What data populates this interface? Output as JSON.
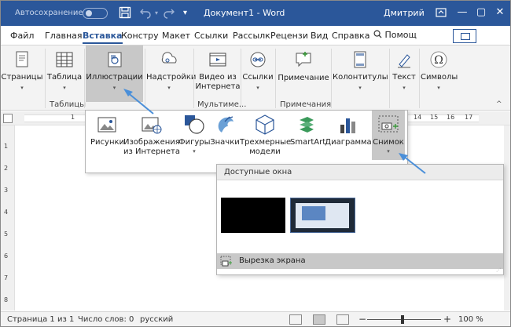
{
  "titlebar": {
    "autosave_label": "Автосохранение",
    "document_title": "Документ1 - Word",
    "user_name": "Дмитрий",
    "minimize": "—",
    "restore": "▢",
    "close": "✕"
  },
  "tabs": [
    {
      "label": "Файл"
    },
    {
      "label": "Главная"
    },
    {
      "label": "Вставка"
    },
    {
      "label": "Констру"
    },
    {
      "label": "Макет"
    },
    {
      "label": "Ссылки"
    },
    {
      "label": "Рассылк"
    },
    {
      "label": "Рецензи"
    },
    {
      "label": "Вид"
    },
    {
      "label": "Справка"
    }
  ],
  "search_label": "Помощ",
  "ribbon": {
    "pages": "Страницы",
    "table": "Таблица",
    "illustrations": "Иллюстрации",
    "addins": "Надстройки",
    "video_line1": "Видео из",
    "video_line2": "Интернета",
    "links": "Ссылки",
    "comment": "Примечание",
    "header_footer": "Колонтитулы",
    "text": "Текст",
    "symbols": "Символы",
    "group_tables": "Таблицы",
    "group_media": "Мультиме...",
    "group_comments": "Примечания"
  },
  "ruler": {
    "marks": [
      "1",
      "14",
      "15",
      "16",
      "17"
    ]
  },
  "vruler": {
    "marks": [
      "1",
      "2",
      "3",
      "4",
      "5",
      "6",
      "7",
      "8"
    ]
  },
  "illustrations_menu": {
    "pictures": "Рисунки",
    "online_line1": "Изображения",
    "online_line2": "из Интернета",
    "shapes": "Фигуры",
    "icons": "Значки",
    "models_line1": "Трехмерные",
    "models_line2": "модели",
    "smartart": "SmartArt",
    "chart": "Диаграмма",
    "screenshot": "Снимок"
  },
  "snapshot_panel": {
    "header": "Доступные окна",
    "screen_clipping": "Вырезка экрана"
  },
  "statusbar": {
    "page": "Страница 1 из 1",
    "words": "Число слов: 0",
    "language": "русский",
    "zoom": "100 %",
    "zoom_minus": "−",
    "zoom_plus": "+"
  },
  "colors": {
    "title_bar": "#2b579a",
    "accent": "#2b579a",
    "arrow": "#4a8fd9",
    "selected": "#c8c8c8"
  }
}
